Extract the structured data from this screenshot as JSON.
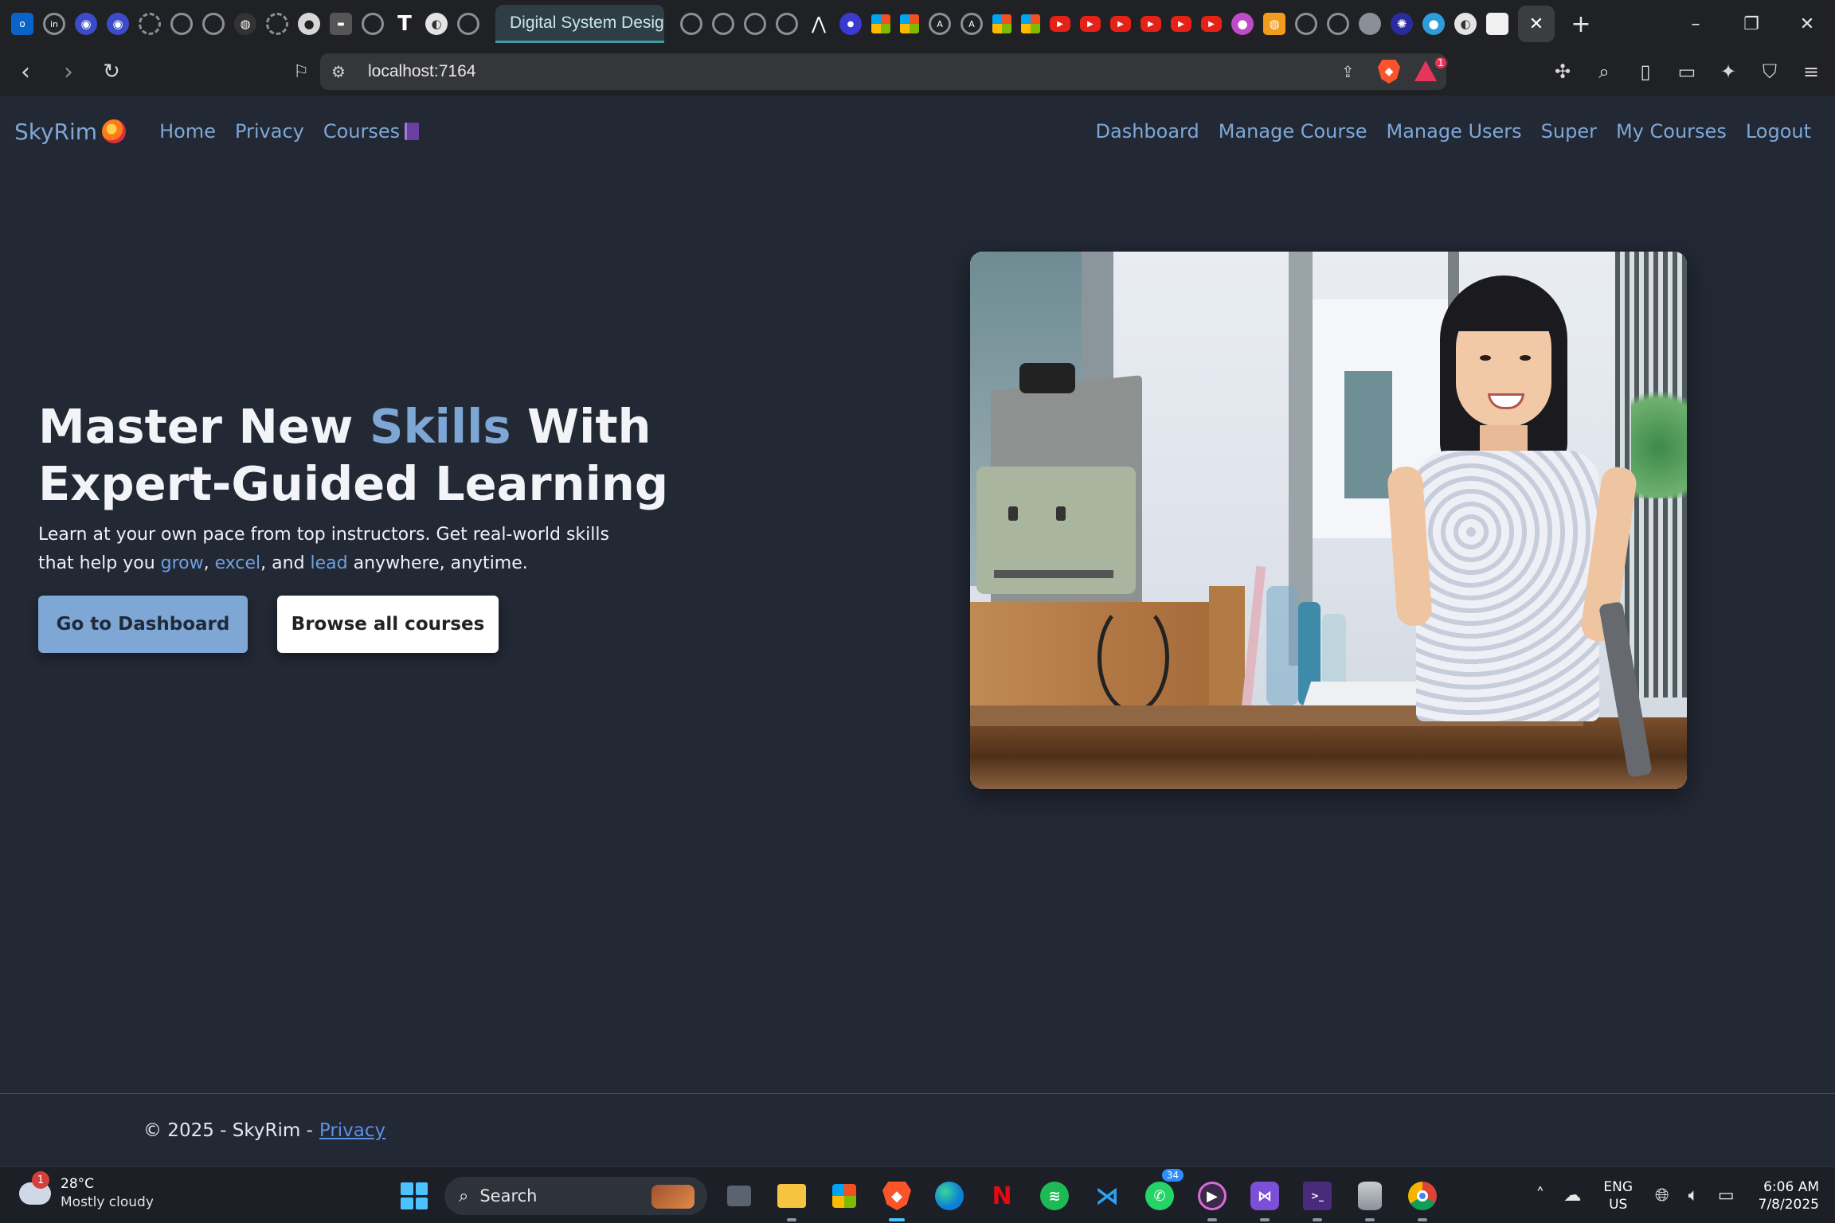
{
  "browser": {
    "active_tab_title": "Digital System Desig",
    "url": "localhost:7164",
    "rewards_badge": "1",
    "window_controls": {
      "minimize": "–",
      "restore": "❐",
      "close": "✕"
    },
    "new_tab": "+",
    "close_tab": "✕"
  },
  "nav": {
    "brand": "SkyRim",
    "left": [
      "Home",
      "Privacy",
      "Courses"
    ],
    "right": [
      "Dashboard",
      "Manage Course",
      "Manage Users",
      "Super",
      "My Courses",
      "Logout"
    ]
  },
  "hero": {
    "title_part1": "Master New ",
    "title_accent": "Skills",
    "title_part2": " With Expert-Guided Learning",
    "lead_part1": "Learn at your own pace from top instructors. Get real-world skills that help you ",
    "lead_word1": "grow",
    "lead_sep1": ", ",
    "lead_word2": "excel",
    "lead_sep2": ", and ",
    "lead_word3": "lead",
    "lead_part2": " anywhere, anytime.",
    "primary_button": "Go to Dashboard",
    "secondary_button": "Browse all courses"
  },
  "footer": {
    "copyright": "© 2025 - SkyRim -",
    "privacy_link": "Privacy"
  },
  "taskbar": {
    "weather_temp": "28°C",
    "weather_desc": "Mostly cloudy",
    "weather_badge": "1",
    "search_placeholder": "Search",
    "whatsapp_badge": "34",
    "language": "ENG",
    "region": "US",
    "time": "6:06 AM",
    "date": "7/8/2025"
  },
  "colors": {
    "page_bg": "#222834",
    "accent": "#7fa7d6",
    "link": "#6fa0e0",
    "browser_chrome": "#202124"
  }
}
